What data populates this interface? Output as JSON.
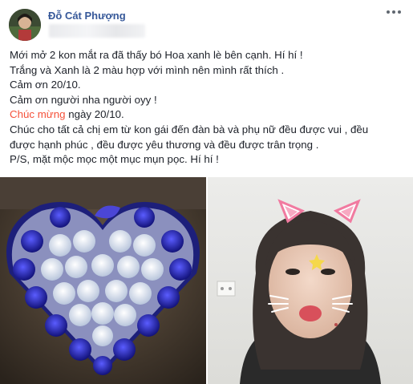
{
  "post": {
    "author": "Đỗ Cát Phượng",
    "lines": [
      "Mới mở 2 kon mắt ra đã thấy bó Hoa xanh lè bên cạnh. Hí hí !",
      "Trắng và Xanh là 2 màu hợp với mình nên mình rất thích .",
      "Cảm ơn 20/10.",
      "Cảm ơn người nha người oyy !"
    ],
    "line5_highlight": "Chúc mừng",
    "line5_rest": " ngày 20/10.",
    "lines_after": [
      "Chúc cho tất cả chị em từ kon gái đến đàn bà và phụ nữ đều được vui , đều",
      "được hạnh phúc , đều được yêu thương và đều được trân trọng .",
      "P/S, mặt mộc mọc một mục mụn pọc. Hí hí !"
    ]
  },
  "icons": {
    "more": "more-horizontal-icon"
  },
  "colors": {
    "author_link": "#365899",
    "highlight": "#f5513a",
    "text": "#1d2129"
  }
}
